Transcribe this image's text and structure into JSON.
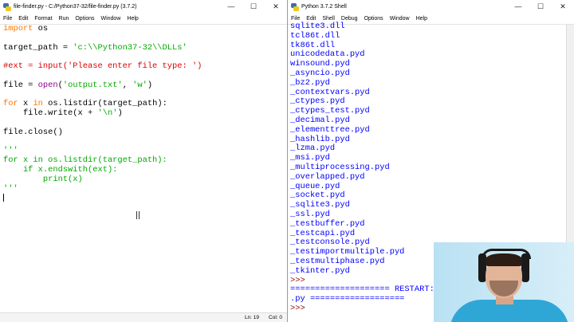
{
  "editor": {
    "title": "file-finder.py - C:/Python37-32/file-finder.py (3.7.2)",
    "menu": [
      "File",
      "Edit",
      "Format",
      "Run",
      "Options",
      "Window",
      "Help"
    ],
    "code": {
      "l1_kw": "import",
      "l1_rest": " os",
      "l2_a": "target_path = ",
      "l2_str": "'c:\\\\Python37-32\\\\DLLs'",
      "l3_comment": "#ext = input('Please enter file type: ')",
      "l4_a": "file = ",
      "l4_bi": "open",
      "l4_b": "(",
      "l4_s1": "'output.txt'",
      "l4_c": ", ",
      "l4_s2": "'w'",
      "l4_d": ")",
      "l5_kw1": "for",
      "l5_a": " x ",
      "l5_kw2": "in",
      "l5_b": " os.listdir(target_path):",
      "l6_a": "    file.write(x + ",
      "l6_str": "'\\n'",
      "l6_b": ")",
      "l7": "file.close()",
      "l8_str": "'''",
      "l9_str": "for x in os.listdir(target_path):",
      "l10_str": "    if x.endswith(ext):",
      "l11_str": "        print(x)",
      "l12_str": "'''"
    },
    "status": {
      "line": "Ln: 19",
      "col": "Col: 0"
    }
  },
  "shell": {
    "title": "Python 3.7.2 Shell",
    "menu": [
      "File",
      "Edit",
      "Shell",
      "Debug",
      "Options",
      "Window",
      "Help"
    ],
    "output": [
      "sqlite3.dll",
      "tcl86t.dll",
      "tk86t.dll",
      "unicodedata.pyd",
      "winsound.pyd",
      "_asyncio.pyd",
      "_bz2.pyd",
      "_contextvars.pyd",
      "_ctypes.pyd",
      "_ctypes_test.pyd",
      "_decimal.pyd",
      "_elementtree.pyd",
      "_hashlib.pyd",
      "_lzma.pyd",
      "_msi.pyd",
      "_multiprocessing.pyd",
      "_overlapped.pyd",
      "_queue.pyd",
      "_socket.pyd",
      "_sqlite3.pyd",
      "_ssl.pyd",
      "_testbuffer.pyd",
      "_testcapi.pyd",
      "_testconsole.pyd",
      "_testimportmultiple.pyd",
      "_testmultiphase.pyd",
      "_tkinter.pyd"
    ],
    "prompt1": ">>>",
    "restart_line1": "==================== RESTART:",
    "restart_line2": ".py ===================",
    "prompt2": ">>>"
  },
  "window_controls": {
    "minimize": "—",
    "maximize": "☐",
    "close": "✕"
  }
}
